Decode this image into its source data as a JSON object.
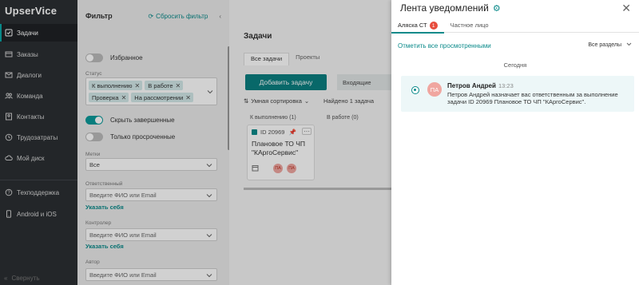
{
  "app": {
    "logo": "UpserVice"
  },
  "sidebar": {
    "items": [
      {
        "label": "Задачи",
        "icon": "tasks-icon",
        "active": true
      },
      {
        "label": "Заказы",
        "icon": "orders-icon"
      },
      {
        "label": "Диалоги",
        "icon": "dialogs-icon"
      },
      {
        "label": "Команда",
        "icon": "team-icon"
      },
      {
        "label": "Контакты",
        "icon": "contacts-icon"
      },
      {
        "label": "Трудозатраты",
        "icon": "clock-icon"
      },
      {
        "label": "Мой диск",
        "icon": "cloud-icon"
      },
      {
        "label": "Техподдержка",
        "icon": "support-icon"
      },
      {
        "label": "Android и iOS",
        "icon": "mobile-icon"
      }
    ],
    "collapse_label": "Свернуть"
  },
  "filter": {
    "title": "Фильтр",
    "reset_label": "Сбросить фильтр",
    "favorites_label": "Избранное",
    "status_label": "Статус",
    "status_chips": [
      "К выполнению",
      "В работе",
      "Проверка",
      "На рассмотрении"
    ],
    "hide_completed_label": "Скрыть завершенные",
    "only_overdue_label": "Только просроченные",
    "tags_label": "Метки",
    "tags_value": "Все",
    "responsible_label": "Ответственный",
    "responsible_placeholder": "Введите ФИО или Email",
    "specify_self_1": "Указать себя",
    "controller_label": "Контролер",
    "controller_placeholder": "Введите ФИО или Email",
    "specify_self_2": "Указать себя",
    "author_label": "Автор",
    "author_placeholder": "Введите ФИО или Email"
  },
  "main": {
    "title": "Задачи",
    "tabs": [
      "Все задачи",
      "Проекты"
    ],
    "add_task_label": "Добавить задачу",
    "incoming_label": "Входящие",
    "sort_label": "Умная сортировка",
    "found_label": "Найдено 1 задача",
    "columns": [
      {
        "label": "К выполнению (1)"
      },
      {
        "label": "В работе (0)"
      }
    ],
    "card": {
      "id": "ID 20969",
      "title": "Плановое ТО ЧП \"КАргоСервис\"",
      "avatars": [
        "ПА",
        "ПА"
      ]
    }
  },
  "notifications": {
    "title": "Лента уведомлений",
    "tabs": [
      {
        "label": "Аляска СТ",
        "badge": "1"
      },
      {
        "label": "Частное лицо"
      }
    ],
    "mark_all_label": "Отметить все просмотренными",
    "sections_label": "Все разделы",
    "day_label": "Сегодня",
    "items": [
      {
        "avatar": "ПА",
        "author": "Петров Андрей",
        "time": "13:23",
        "text": "Петров Андрей назначает вас ответственным за выполнение задачи ID 20969 Плановое ТО ЧП \"КАргоСервис\"."
      }
    ]
  },
  "colors": {
    "accent": "#0a8a8a",
    "sidebar_bg": "#2b2f33",
    "badge": "#e74c3c"
  }
}
